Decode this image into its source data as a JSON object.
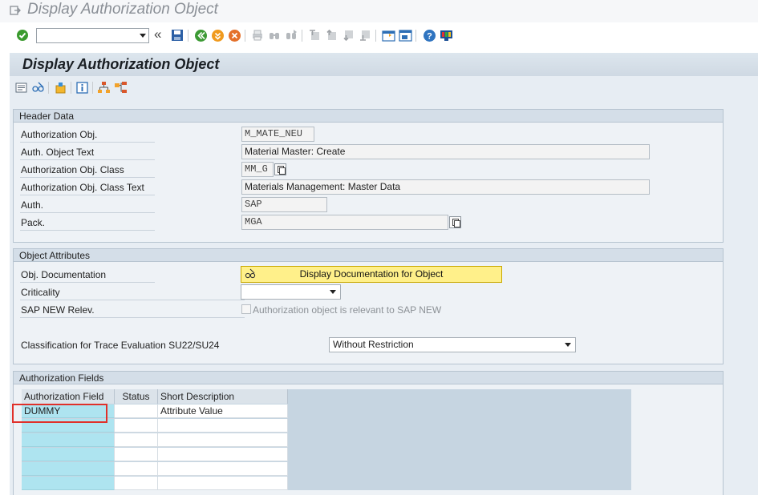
{
  "window": {
    "title": "Display Authorization Object"
  },
  "toolbar": {
    "command_field_value": "",
    "icons": [
      "enter-icon",
      "back-icon",
      "exit-icon",
      "cancel-icon",
      "print-icon",
      "find-icon",
      "find-next-icon",
      "first-page-icon",
      "previous-page-icon",
      "next-page-icon",
      "last-page-icon",
      "new-session-icon",
      "shortcut-icon",
      "help-icon",
      "customize-layout-icon"
    ]
  },
  "screen": {
    "title": "Display Authorization Object"
  },
  "header_data": {
    "title": "Header Data",
    "auth_obj_label": "Authorization Obj.",
    "auth_obj_value": "M_MATE_NEU",
    "auth_obj_text_label": "Auth. Object Text",
    "auth_obj_text_value": "Material Master: Create",
    "auth_obj_class_label": "Authorization Obj. Class",
    "auth_obj_class_value": "MM_G",
    "auth_obj_class_text_label": "Authorization Obj. Class Text",
    "auth_obj_class_text_value": "Materials Management: Master Data",
    "auth_label": "Auth.",
    "auth_value": "SAP",
    "pack_label": "Pack.",
    "pack_value": "MGA"
  },
  "object_attributes": {
    "title": "Object Attributes",
    "obj_doc_label": "Obj. Documentation",
    "doc_button_label": "Display Documentation for Object",
    "criticality_label": "Criticality",
    "criticality_value": "",
    "sap_new_label": "SAP NEW Relev.",
    "sap_new_checkbox_label": "Authorization object is relevant to SAP NEW",
    "trace_label": "Classification for Trace Evaluation SU22/SU24",
    "trace_value": "Without Restriction"
  },
  "auth_fields": {
    "title": "Authorization Fields",
    "columns": [
      "Authorization Field",
      "Status",
      "Short Description"
    ],
    "rows": [
      {
        "field": "DUMMY",
        "status": "",
        "description": "Attribute Value"
      }
    ]
  },
  "colors": {
    "highlight_box": "#e0302a",
    "doc_button": "#fff08a",
    "selected_column": "#aee4f0"
  }
}
